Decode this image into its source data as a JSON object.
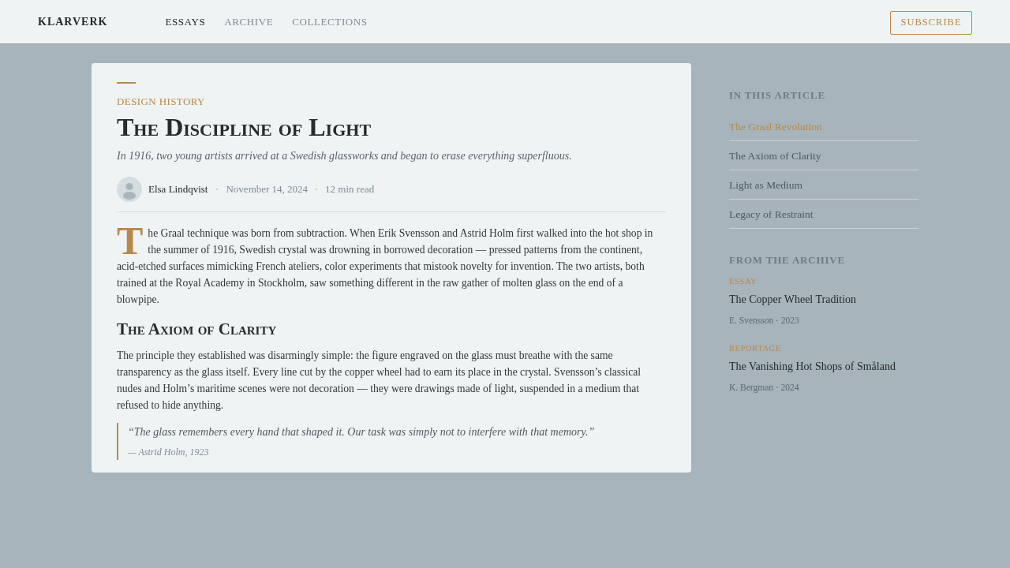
{
  "header": {
    "logo": "KLARVERK",
    "nav": [
      {
        "label": "ESSAYS",
        "selected": true
      },
      {
        "label": "ARCHIVE",
        "selected": false
      },
      {
        "label": "COLLECTIONS",
        "selected": false
      }
    ],
    "subscribe_button": "SUBSCRIBE"
  },
  "article": {
    "category": "DESIGN HISTORY",
    "title": "The Discipline of Light",
    "subtitle": "In 1916, two young artists arrived at a Swedish glassworks and began to erase everything superfluous.",
    "author": {
      "name": "Elsa Lindqvist",
      "date": "November 14, 2024",
      "read_time": "12 min read"
    },
    "body": [
      {
        "kind": "paragraph",
        "drop_cap": true,
        "text": "The Graal technique was born from subtraction. When Erik Svensson and Astrid Holm first walked into the hot shop in the summer of 1916, Swedish crystal was drowning in borrowed decoration — pressed patterns from the continent, acid-etched surfaces mimicking French ateliers, color experiments that mistook novelty for invention. The two artists, both trained at the Royal Academy in Stockholm, saw something different in the raw gather of molten glass on the end of a blowpipe."
      },
      {
        "kind": "heading",
        "text": "The Axiom of Clarity"
      },
      {
        "kind": "paragraph",
        "drop_cap": false,
        "text": "The principle they established was disarmingly simple: the figure engraved on the glass must breathe with the same transparency as the glass itself. Every line cut by the copper wheel had to earn its place in the crystal. Svensson’s classical nudes and Holm’s maritime scenes were not decoration — they were drawings made of light, suspended in a medium that refused to hide anything."
      },
      {
        "kind": "quote",
        "text": "“The glass remembers every hand that shaped it. Our task was simply not to interfere with that memory.”",
        "cite": "— Astrid Holm, 1923"
      }
    ]
  },
  "sidebar": {
    "toc": {
      "heading": "IN THIS ARTICLE",
      "items": [
        {
          "label": "The Graal Revolution",
          "selected": true
        },
        {
          "label": "The Axiom of Clarity",
          "selected": false
        },
        {
          "label": "Light as Medium",
          "selected": false
        },
        {
          "label": "Legacy of Restraint",
          "selected": false
        }
      ]
    },
    "archive": {
      "heading": "FROM THE ARCHIVE",
      "items": [
        {
          "category": "ESSAY",
          "title": "The Copper Wheel Tradition",
          "meta": "E. Svensson · 2023"
        },
        {
          "category": "REPORTAGE",
          "title": "The Vanishing Hot Shops of Småland",
          "meta": "K. Bergman · 2024"
        }
      ]
    }
  }
}
